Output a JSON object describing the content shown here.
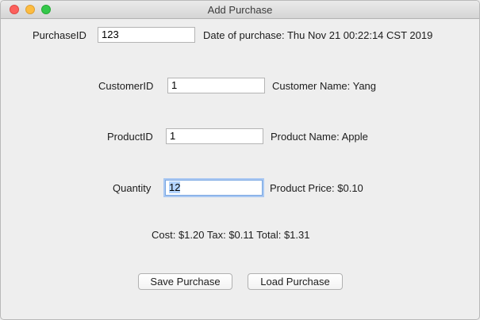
{
  "window": {
    "title": "Add Purchase"
  },
  "purchase": {
    "id_label": "PurchaseID",
    "id_value": "123",
    "date_text": "Date of purchase: Thu Nov 21 00:22:14 CST 2019"
  },
  "customer": {
    "id_label": "CustomerID",
    "id_value": "1",
    "name_text": "Customer Name: Yang"
  },
  "product": {
    "id_label": "ProductID",
    "id_value": "1",
    "name_text": "Product Name: Apple"
  },
  "quantity": {
    "label": "Quantity",
    "value": "12",
    "price_text": "Product Price: $0.10"
  },
  "summary": {
    "text": "Cost: $1.20 Tax: $0.11 Total: $1.31"
  },
  "buttons": {
    "save_label": "Save Purchase",
    "load_label": "Load Purchase"
  }
}
